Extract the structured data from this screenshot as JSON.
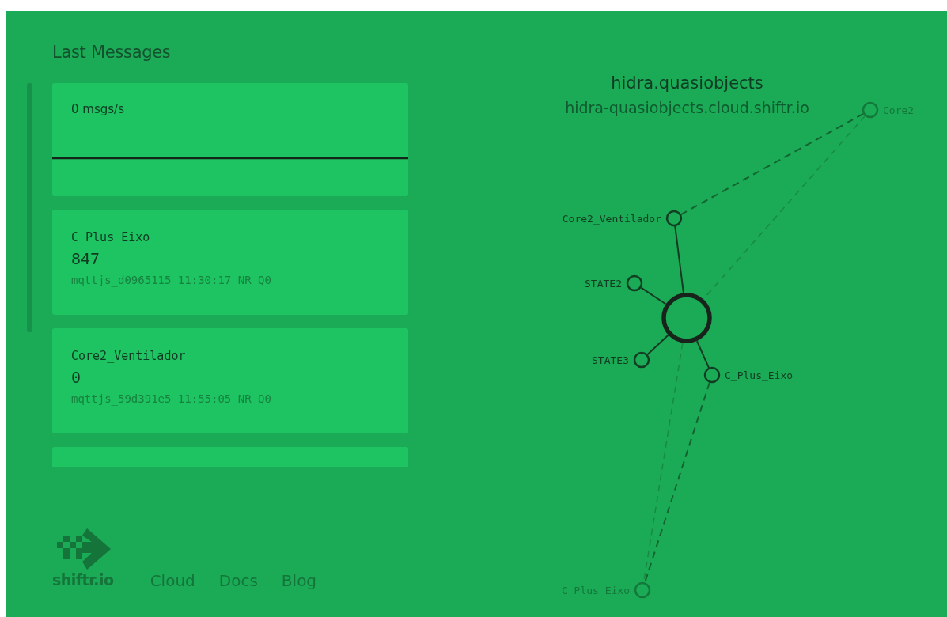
{
  "heading": "Last Messages",
  "cards": [
    {
      "kind": "rate",
      "text": "0 msgs/s"
    },
    {
      "kind": "message",
      "topic": "C_Plus_Eixo",
      "payload": "847",
      "meta": "mqttjs_d0965115 11:30:17 NR Q0"
    },
    {
      "kind": "message",
      "topic": "Core2_Ventilador",
      "payload": "0",
      "meta": "mqttjs_59d391e5 11:55:05 NR Q0"
    },
    {
      "kind": "partial"
    }
  ],
  "footer": {
    "logo": "shiftr.io",
    "links": [
      "Cloud",
      "Docs",
      "Blog"
    ]
  },
  "namespace": {
    "title": "hidra.quasiobjects",
    "url": "hidra-quasiobjects.cloud.shiftr.io"
  },
  "graph": {
    "nodes": [
      {
        "label": "Core2",
        "faded": true
      },
      {
        "label": "Core2_Ventilador",
        "faded": false
      },
      {
        "label": "STATE2",
        "faded": false
      },
      {
        "label": "STATE3",
        "faded": false
      },
      {
        "label": "C_Plus_Eixo",
        "faded": false
      },
      {
        "label": "C_Plus_Eixo",
        "faded": true
      }
    ]
  }
}
